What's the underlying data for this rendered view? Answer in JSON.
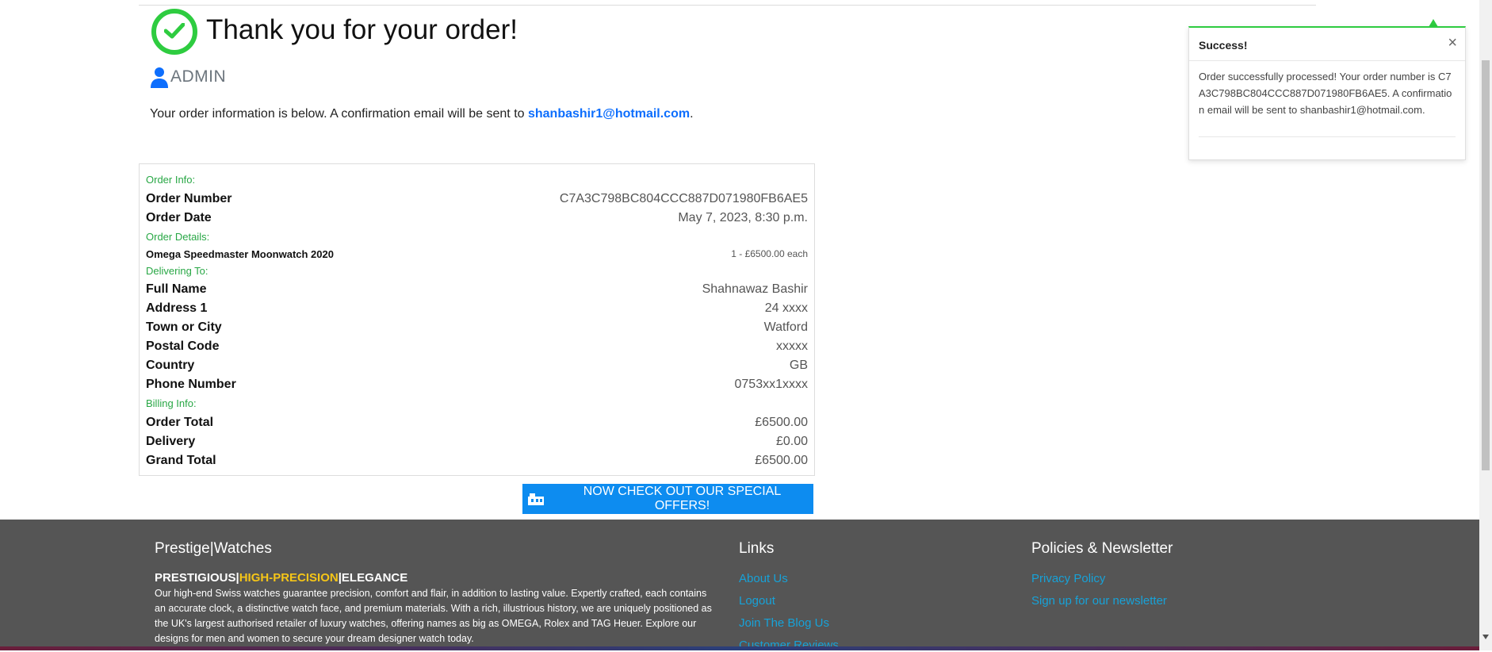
{
  "header": {
    "title": "Thank you for your order!",
    "user": "ADMIN",
    "info_text": "Your order information is below. A confirmation email will be sent to ",
    "email": "shanbashir1@hotmail.com",
    "info_suffix": "."
  },
  "order": {
    "sections": {
      "order_info": "Order Info:",
      "order_details": "Order Details:",
      "delivering_to": "Delivering To:",
      "billing_info": "Billing Info:"
    },
    "order_number_label": "Order Number",
    "order_number": "C7A3C798BC804CCC887D071980FB6AE5",
    "order_date_label": "Order Date",
    "order_date": "May 7, 2023, 8:30 p.m.",
    "item_name": "Omega Speedmaster Moonwatch 2020",
    "item_qty": "1 - £6500.00 each",
    "delivery_rows": [
      {
        "label": "Full Name",
        "value": "Shahnawaz Bashir"
      },
      {
        "label": "Address 1",
        "value": "24 xxxx"
      },
      {
        "label": "Town or City",
        "value": "Watford"
      },
      {
        "label": "Postal Code",
        "value": "xxxxx"
      },
      {
        "label": "Country",
        "value": "GB"
      },
      {
        "label": "Phone Number",
        "value": "0753xx1xxxx"
      }
    ],
    "billing_rows": [
      {
        "label": "Order Total",
        "value": "£6500.00"
      },
      {
        "label": "Delivery",
        "value": "£0.00"
      },
      {
        "label": "Grand Total",
        "value": "£6500.00"
      }
    ]
  },
  "offers_button": "NOW CHECK OUT OUR SPECIAL OFFERS!",
  "toast": {
    "title": "Success!",
    "close": "×",
    "message": "Order successfully processed! Your order number is C7A3C798BC804CCC887D071980FB6AE5. A confirmation email will be sent to shanbashir1@hotmail.com."
  },
  "footer": {
    "brand": "Prestige|Watches",
    "tagline": {
      "a": "PRESTIGIOUS|",
      "b": "HIGH-PRECISION",
      "c": "|ELEGANCE"
    },
    "description": "Our high-end Swiss watches guarantee precision, comfort and flair, in addition to lasting value. Expertly crafted, each contains an accurate clock, a distinctive watch face, and premium materials. With a rich, illustrious history, we are uniquely positioned as the UK's largest authorised retailer of luxury watches, offering names as big as OMEGA, Rolex and TAG Heuer. Explore our designs for men and women to secure your dream designer watch today.",
    "links_title": "Links",
    "links": [
      "About Us",
      "Logout",
      "Join The Blog Us",
      "Customer Reviews"
    ],
    "policies_title": "Policies & Newsletter",
    "policies": [
      "Privacy Policy",
      "Sign up for our newsletter"
    ]
  },
  "colors": {
    "success_green": "#2ecc40",
    "link_blue": "#0d6efd",
    "button_blue": "#0d8cf0",
    "footer_bg": "#555555",
    "highlight_yellow": "#f5c518"
  }
}
